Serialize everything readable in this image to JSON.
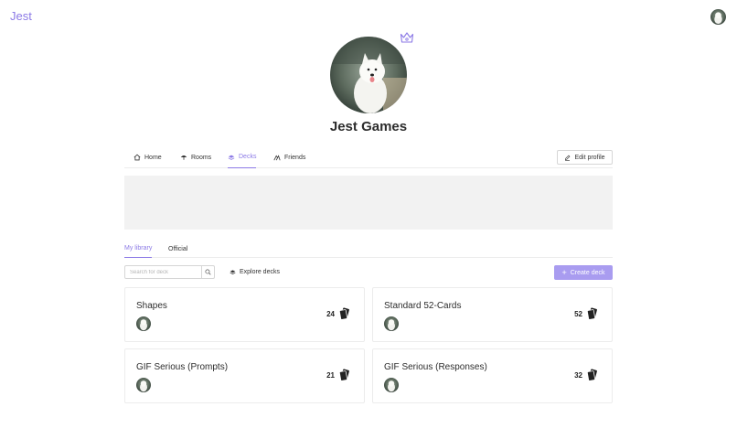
{
  "app": {
    "logo": "Jest"
  },
  "profile": {
    "name": "Jest Games"
  },
  "nav": {
    "tabs": [
      {
        "label": "Home",
        "icon": "home-icon"
      },
      {
        "label": "Rooms",
        "icon": "umbrella-icon"
      },
      {
        "label": "Decks",
        "icon": "stack-icon",
        "active": true
      },
      {
        "label": "Friends",
        "icon": "users-icon"
      }
    ],
    "edit_profile": "Edit profile"
  },
  "library": {
    "tabs": [
      {
        "label": "My library",
        "active": true
      },
      {
        "label": "Official"
      }
    ],
    "search_placeholder": "Search for deck",
    "explore_label": "Explore decks",
    "create_label": "Create deck"
  },
  "decks": [
    {
      "title": "Shapes",
      "count": "24"
    },
    {
      "title": "Standard 52-Cards",
      "count": "52"
    },
    {
      "title": "GIF Serious (Prompts)",
      "count": "21"
    },
    {
      "title": "GIF Serious (Responses)",
      "count": "32"
    }
  ],
  "colors": {
    "accent": "#8c7ae6",
    "accent_button": "#a99cf0",
    "banner": "#f2f2f2"
  }
}
